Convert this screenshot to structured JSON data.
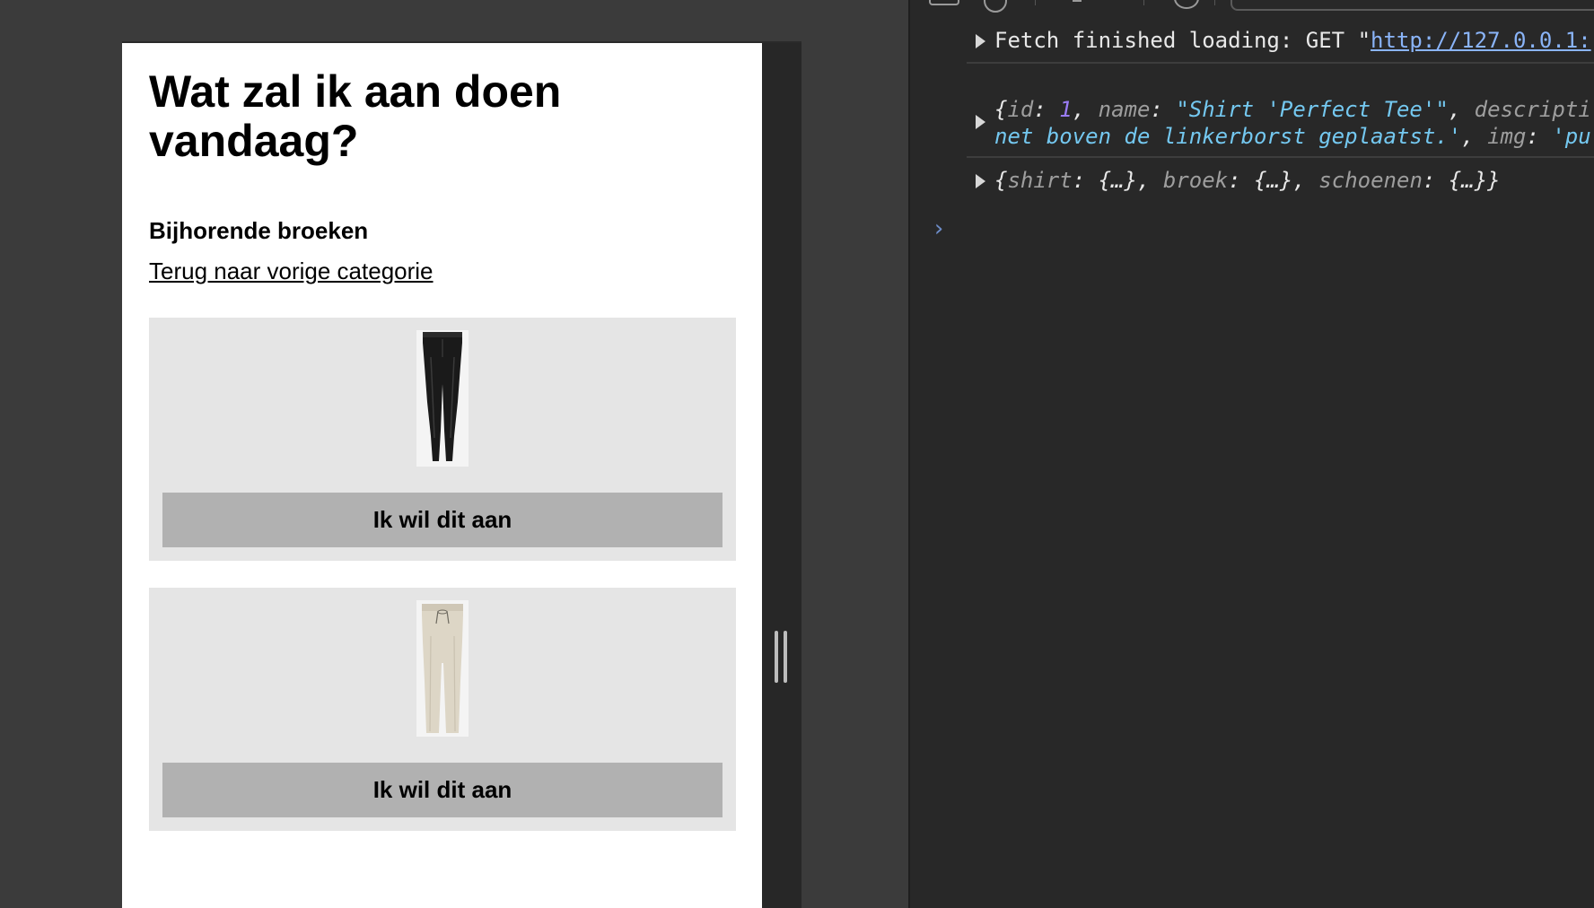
{
  "page": {
    "title": "Wat zal ik aan doen vandaag?",
    "section_title": "Bijhorende broeken",
    "back_link": "Terug naar vorige categorie",
    "products": [
      {
        "button_label": "Ik wil dit aan",
        "image": "black-leather-trousers"
      },
      {
        "button_label": "Ik wil dit aan",
        "image": "beige-jogger-trousers"
      }
    ]
  },
  "devtools": {
    "fetch_text": "Fetch finished loading: GET \"",
    "fetch_url": "http://127.0.0.1:",
    "object1": {
      "k_id": "id",
      "v_id": "1",
      "k_name": "name",
      "v_name": "\"Shirt 'Perfect Tee'\"",
      "k_descr": "descripti",
      "v_descr_cont": "net boven de linkerborst geplaatst.'",
      "k_img": "img",
      "v_img": "'pu"
    },
    "object2": {
      "k_shirt": "shirt",
      "k_broek": "broek",
      "k_schoenen": "schoenen",
      "collapsed": "{…}"
    },
    "prompt_symbol": "›"
  },
  "colors": {
    "card_bg": "#e5e5e5",
    "button_bg": "#b1b1b1",
    "devtools_bg": "#282828",
    "string": "#74c8f0",
    "number": "#9a7cf5"
  }
}
